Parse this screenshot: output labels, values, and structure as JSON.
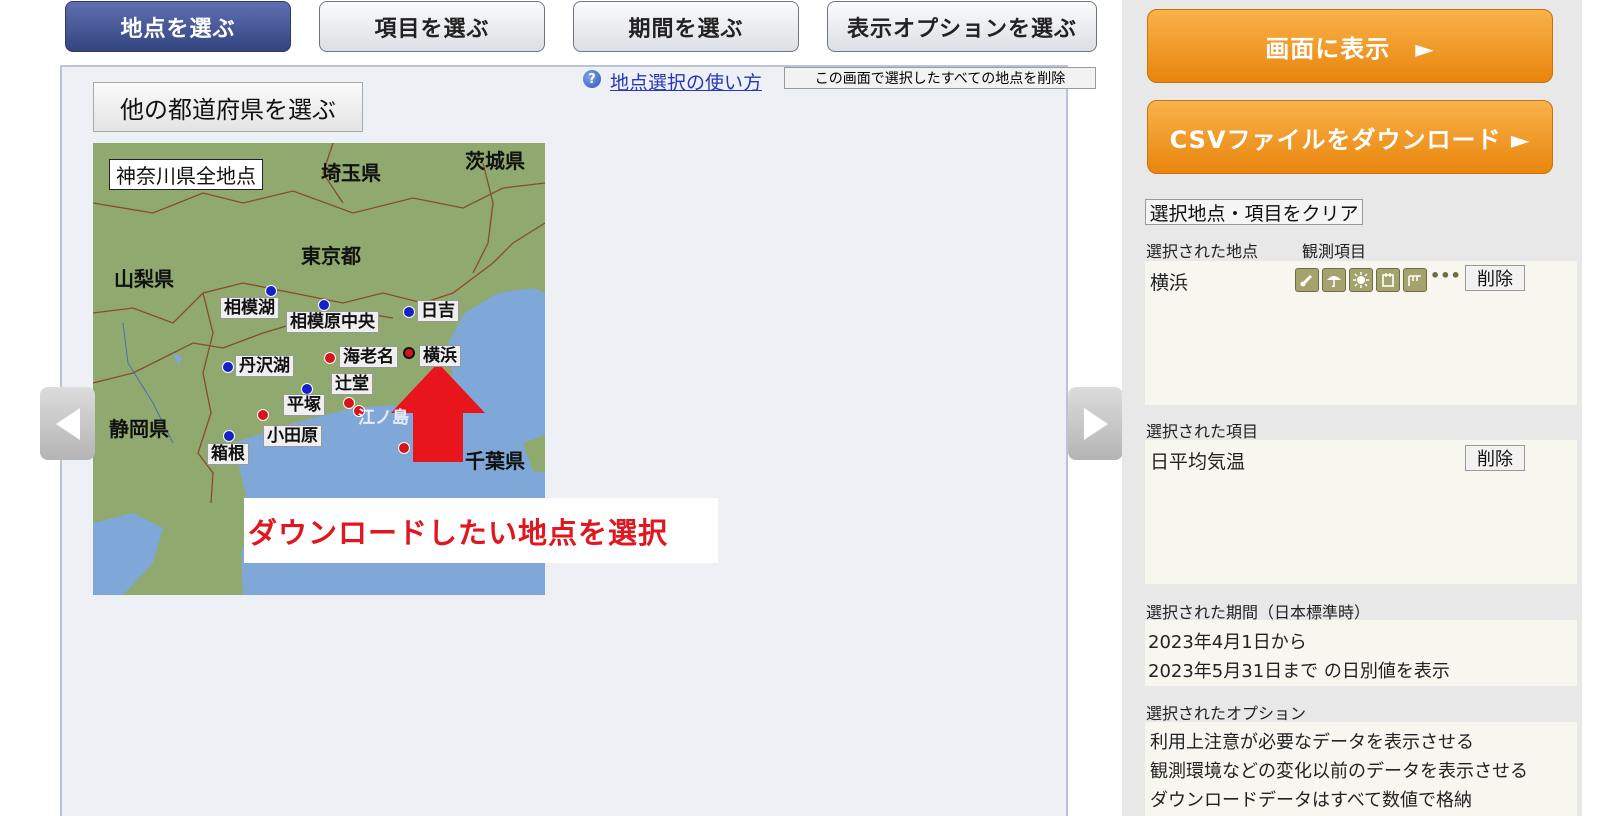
{
  "tabs": {
    "location": "地点を選ぶ",
    "items": "項目を選ぶ",
    "period": "期間を選ぶ",
    "options": "表示オプションを選ぶ"
  },
  "panel": {
    "help_link": "地点選択の使い方",
    "clear_all": "この画面で選択したすべての地点を削除",
    "prefecture_button": "他の都道府県を選ぶ"
  },
  "map": {
    "title": "神奈川県全地点",
    "regions": [
      "埼玉県",
      "茨城県",
      "東京都",
      "山梨県",
      "静岡県",
      "千葉県"
    ],
    "stations": [
      "相模湖",
      "相模原中央",
      "日吉",
      "丹沢湖",
      "海老名",
      "横浜",
      "辻堂",
      "平塚",
      "江ノ島",
      "小田原",
      "箱根"
    ],
    "annotation": "ダウンロードしたい地点を選択",
    "colors": {
      "land": "#8fa96e",
      "sea": "#7fa8d8",
      "observed": "#1420c8",
      "amedas": "#d8131a",
      "arrow": "#e8151c"
    }
  },
  "right": {
    "show_button": "画面に表示　►",
    "csv_button": "CSVファイルをダウンロード ►",
    "clear_button": "選択地点・項目をクリア",
    "selected_location_label": "選択された地点",
    "observation_items_label": "観測項目",
    "selected_location": "横浜",
    "delete_label": "削除",
    "more_icons": "•••",
    "selected_items_label": "選択された項目",
    "selected_item": "日平均気温",
    "selected_period_label": "選択された期間（日本標準時）",
    "period_from": "2023年4月1日から",
    "period_to": "2023年5月31日まで の日別値を表示",
    "selected_options_label": "選択されたオプション",
    "options": [
      "利用上注意が必要なデータを表示させる",
      "観測環境などの変化以前のデータを表示させる",
      "ダウンロードデータはすべて数値で格納"
    ],
    "obs_icons": [
      "thermometer-icon",
      "umbrella-icon",
      "sun-icon",
      "snow-icon",
      "wind-icon"
    ]
  }
}
